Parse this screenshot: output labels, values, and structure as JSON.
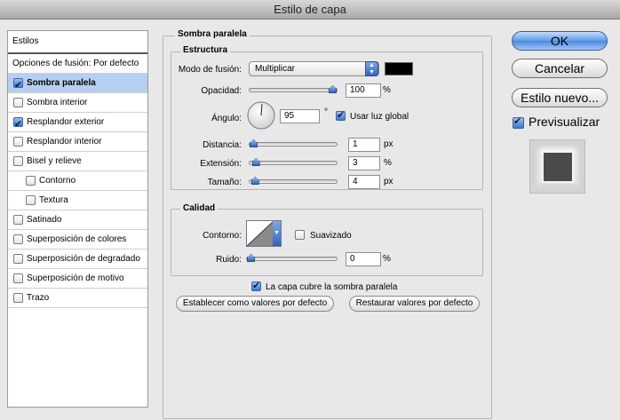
{
  "window": {
    "title": "Estilo de capa"
  },
  "sidebar": {
    "header": "Estilos",
    "blend_options": "Opciones de fusión: Por defecto",
    "items": [
      {
        "label": "Sombra paralela",
        "checked": true,
        "selected": true
      },
      {
        "label": "Sombra interior",
        "checked": false
      },
      {
        "label": "Resplandor exterior",
        "checked": true
      },
      {
        "label": "Resplandor interior",
        "checked": false
      },
      {
        "label": "Bisel y relieve",
        "checked": false
      },
      {
        "label": "Contorno",
        "checked": false
      },
      {
        "label": "Textura",
        "checked": false
      },
      {
        "label": "Satinado",
        "checked": false
      },
      {
        "label": "Superposición de colores",
        "checked": false
      },
      {
        "label": "Superposición de degradado",
        "checked": false
      },
      {
        "label": "Superposición de motivo",
        "checked": false
      },
      {
        "label": "Trazo",
        "checked": false
      }
    ]
  },
  "panel": {
    "title": "Sombra paralela",
    "structure": {
      "legend": "Estructura",
      "blend_mode_label": "Modo de fusión:",
      "blend_mode_value": "Multiplicar",
      "shadow_color": "#000000",
      "opacity_label": "Opacidad:",
      "opacity_value": "100",
      "opacity_unit": "%",
      "opacity_level": 1.0,
      "angle_label": "Ángulo:",
      "angle_value": "95",
      "angle_unit": "°",
      "global_light_label": "Usar luz global",
      "global_light_checked": true,
      "distance_label": "Distancia:",
      "distance_value": "1",
      "distance_unit": "px",
      "distance_level": 0.0,
      "spread_label": "Extensión:",
      "spread_value": "3",
      "spread_unit": "%",
      "spread_level": 0.03,
      "size_label": "Tamaño:",
      "size_value": "4",
      "size_unit": "px",
      "size_level": 0.02
    },
    "quality": {
      "legend": "Calidad",
      "contour_label": "Contorno:",
      "antialias_label": "Suavizado",
      "antialias_checked": false,
      "noise_label": "Ruido:",
      "noise_value": "0",
      "noise_unit": "%",
      "noise_level": 0.0
    },
    "knockout_label": "La capa cubre la sombra paralela",
    "knockout_checked": true,
    "make_default_label": "Establecer como valores por defecto",
    "reset_default_label": "Restaurar valores por defecto"
  },
  "actions": {
    "ok_label": "OK",
    "cancel_label": "Cancelar",
    "new_style_label": "Estilo nuevo...",
    "preview_label": "Previsualizar",
    "preview_checked": true
  },
  "colors": {
    "accent": "#4a8ae2",
    "selection": "#b6cff1"
  }
}
